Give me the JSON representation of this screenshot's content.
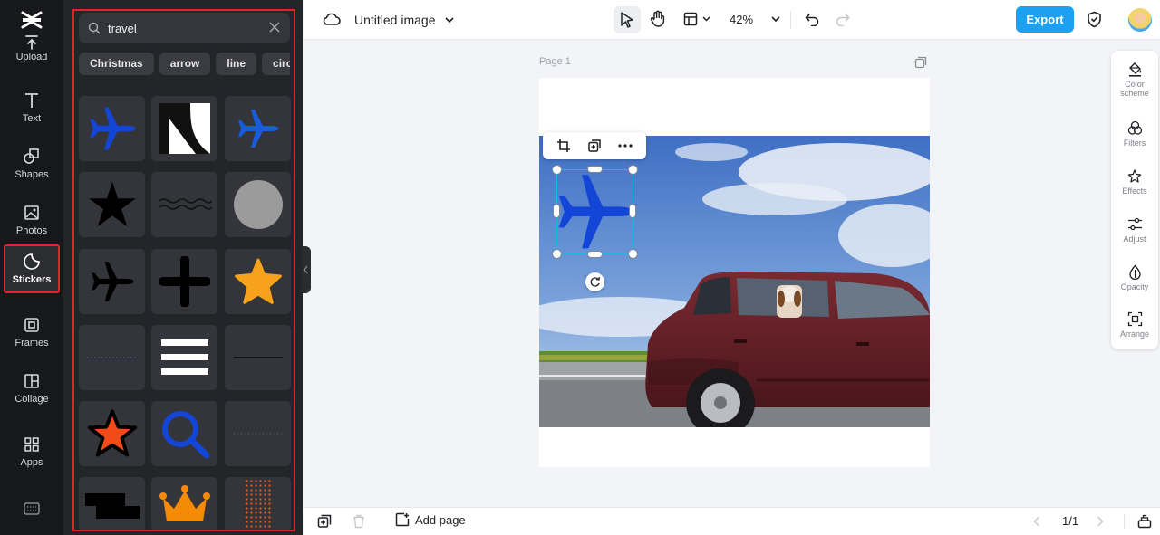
{
  "rail": {
    "items": [
      {
        "label": "Upload"
      },
      {
        "label": "Text"
      },
      {
        "label": "Shapes"
      },
      {
        "label": "Photos"
      },
      {
        "label": "Stickers",
        "active": true
      },
      {
        "label": "Frames"
      },
      {
        "label": "Collage"
      },
      {
        "label": "Apps"
      }
    ]
  },
  "panel": {
    "search": {
      "value": "travel",
      "placeholder": ""
    },
    "chips": [
      "Christmas",
      "arrow",
      "line",
      "circle"
    ],
    "stickers": [
      "airplane-blue",
      "diagonal-shape",
      "airplane-blue",
      "star-black",
      "wavy-lines",
      "circle-gray",
      "airplane-black",
      "cross-black",
      "star-orange",
      "dotted-line",
      "three-bars-white",
      "thin-line",
      "star-red",
      "magnifier-blue",
      "dotted-line",
      "blocks-black",
      "crown-orange",
      "dots-orange"
    ]
  },
  "topbar": {
    "title": "Untitled image",
    "zoom": "42%",
    "export_label": "Export"
  },
  "canvas": {
    "page_label": "Page 1"
  },
  "rightpanel": {
    "items": [
      {
        "label": "Color scheme"
      },
      {
        "label": "Filters"
      },
      {
        "label": "Effects"
      },
      {
        "label": "Adjust"
      },
      {
        "label": "Opacity"
      },
      {
        "label": "Arrange"
      }
    ]
  },
  "bottombar": {
    "add_page_label": "Add page",
    "pager": "1/1"
  },
  "colors": {
    "accent": "#1ba0f2",
    "highlight": "#e0242b",
    "sticker_blue": "#1346d6",
    "sticker_orange": "#f58a07"
  }
}
